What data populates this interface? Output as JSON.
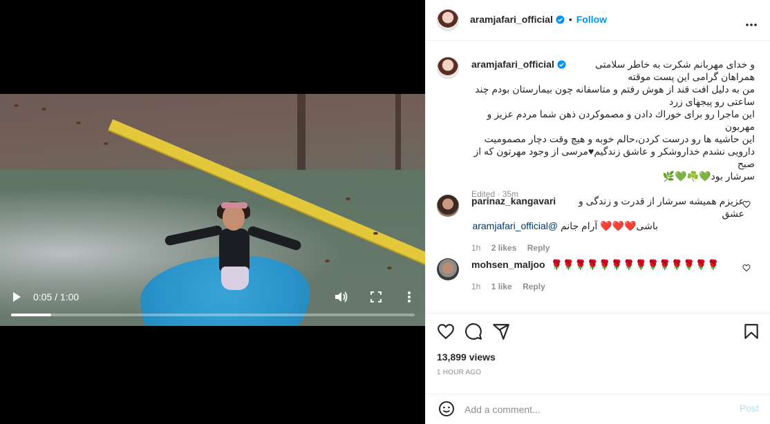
{
  "video": {
    "time_display": "0:05 / 1:00",
    "progress_fraction": 0.1,
    "icons": [
      "play-icon",
      "volume-icon",
      "fullscreen-icon",
      "more-vertical-icon"
    ]
  },
  "header": {
    "username": "aramjafari_official",
    "separator": "•",
    "follow_label": "Follow",
    "more_icon": "more-horizontal-icon"
  },
  "caption": {
    "username": "aramjafari_official",
    "lines": [
      "و خدای مهربانم شکرت به خاطر سلامتی",
      "همراهان گرامی این پست موقته",
      "من به دلیل افت قند از هوش رفتم و متاسفانه چون بیمارستان بودم چند",
      "ساعتی رو پیجهای زرد",
      "این ماجرا رو برای خوراك دادن و مصموکردن ذهن شما مردم عزیز و مهربون",
      "این حاشیه ها رو درست کردن،حالم خوبه و هیچ وقت دچار مصمومیت",
      "دارویی نشدم خداروشکر و عاشق زندگیم♥مرسی از وجود مهرتون که از صبح",
      "سرشار بود💚☘️💚🌿"
    ],
    "meta": "Edited · 35m"
  },
  "comments": [
    {
      "username": "parinaz_kangavari",
      "line1": "عزیزم همیشه سرشار از قدرت و زندگی و عشق",
      "mention": "@aramjafari_official",
      "line2": "باشی❤️❤️❤️ آرام جانم",
      "time": "1h",
      "likes": "2 likes",
      "reply": "Reply"
    },
    {
      "username": "mohsen_maljoo",
      "text": "🌹🌹🌹🌹🌹🌹🌹🌹🌹🌹🌹🌹🌹🌹",
      "time": "1h",
      "likes": "1 like",
      "reply": "Reply"
    }
  ],
  "actions": {
    "icons": [
      "heart-icon",
      "comment-icon",
      "share-icon",
      "bookmark-icon"
    ],
    "views": "13,899 views",
    "ago": "1 HOUR AGO"
  },
  "add_comment": {
    "placeholder": "Add a comment...",
    "post_label": "Post",
    "emoji_icon": "emoji-icon"
  },
  "colors": {
    "accent": "#0095f6",
    "verified": "#0095f6",
    "heart_red": "#ed4956",
    "muted": "#8e8e8e"
  }
}
